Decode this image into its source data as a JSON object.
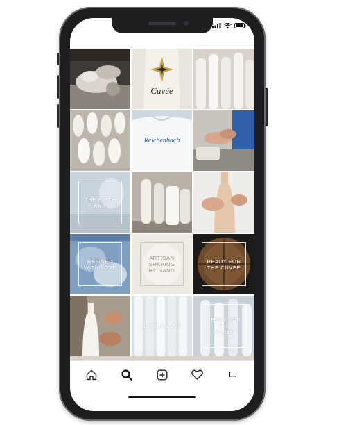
{
  "status_bar": {
    "icons": [
      "signal-icon",
      "wifi-icon",
      "battery-icon"
    ]
  },
  "feed": {
    "tiles": [
      {
        "row": 1,
        "col": 1,
        "subject": "hands-flour",
        "text": ""
      },
      {
        "row": 1,
        "col": 2,
        "subject": "cuvee-bottle-label",
        "text": "Cuvée"
      },
      {
        "row": 1,
        "col": 3,
        "subject": "white-bottles",
        "text": ""
      },
      {
        "row": 2,
        "col": 1,
        "subject": "white-bottles-rows",
        "text": ""
      },
      {
        "row": 2,
        "col": 2,
        "subject": "reichenbach-shirt",
        "text": "Reichenbach"
      },
      {
        "row": 2,
        "col": 3,
        "subject": "hands-washing",
        "text": ""
      },
      {
        "row": 3,
        "col": 1,
        "subject": "birth-card",
        "text": "THE BIRTH No.1"
      },
      {
        "row": 3,
        "col": 2,
        "subject": "bottles-workshop",
        "text": ""
      },
      {
        "row": 3,
        "col": 3,
        "subject": "hand-bottle",
        "text": ""
      },
      {
        "row": 4,
        "col": 1,
        "subject": "refined-card",
        "text": "REFINED WITH LOVE"
      },
      {
        "row": 4,
        "col": 2,
        "subject": "artisan-card",
        "text": "ARTISAN SHAPING BY HAND"
      },
      {
        "row": 4,
        "col": 3,
        "subject": "cuvee-card",
        "text": "READY FOR THE CUVEE"
      },
      {
        "row": 5,
        "col": 1,
        "subject": "bottle-shaping",
        "text": ""
      },
      {
        "row": 5,
        "col": 2,
        "subject": "bottle-love-card",
        "text": "BOTTLE LOVE"
      },
      {
        "row": 5,
        "col": 3,
        "subject": "world-card",
        "text": "READY FOR THE WORLD"
      }
    ]
  },
  "tab_bar": {
    "items": [
      {
        "name": "home",
        "icon": "home-icon"
      },
      {
        "name": "search",
        "icon": "search-icon"
      },
      {
        "name": "add",
        "icon": "plus-square-icon"
      },
      {
        "name": "activity",
        "icon": "heart-icon"
      },
      {
        "name": "profile",
        "label": "In."
      }
    ]
  },
  "colors": {
    "phone_frame": "#1e1e20",
    "screen_bg": "#ffffff",
    "barrel_brown": "#6b4a2c",
    "porcelain": "#efeae3",
    "accent_blue": "#2f5fa8",
    "gold": "#c7a045"
  }
}
